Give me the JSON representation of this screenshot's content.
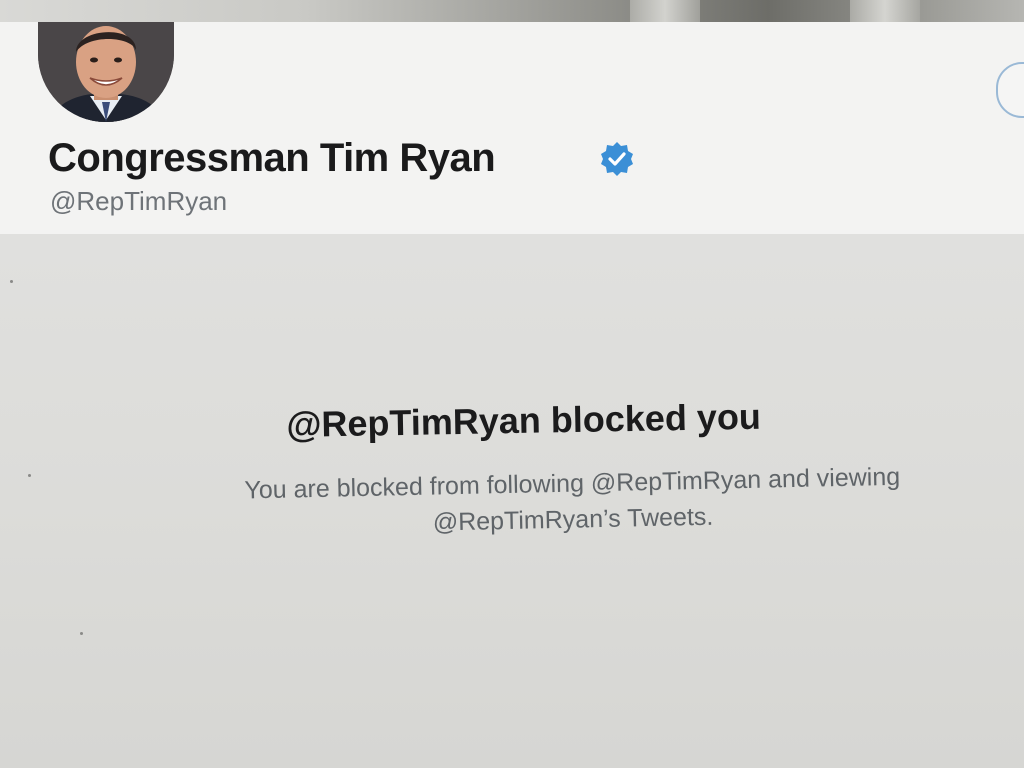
{
  "profile": {
    "display_name": "Congressman Tim Ryan",
    "handle": "@RepTimRyan",
    "verified": true,
    "verified_icon": "verified-badge-icon",
    "accent_color": "#3b8fd6"
  },
  "blocked_notice": {
    "title": "@RepTimRyan blocked you",
    "description_line1": "You are blocked from following @RepTimRyan and viewing",
    "description_line2": "@RepTimRyan’s Tweets."
  }
}
